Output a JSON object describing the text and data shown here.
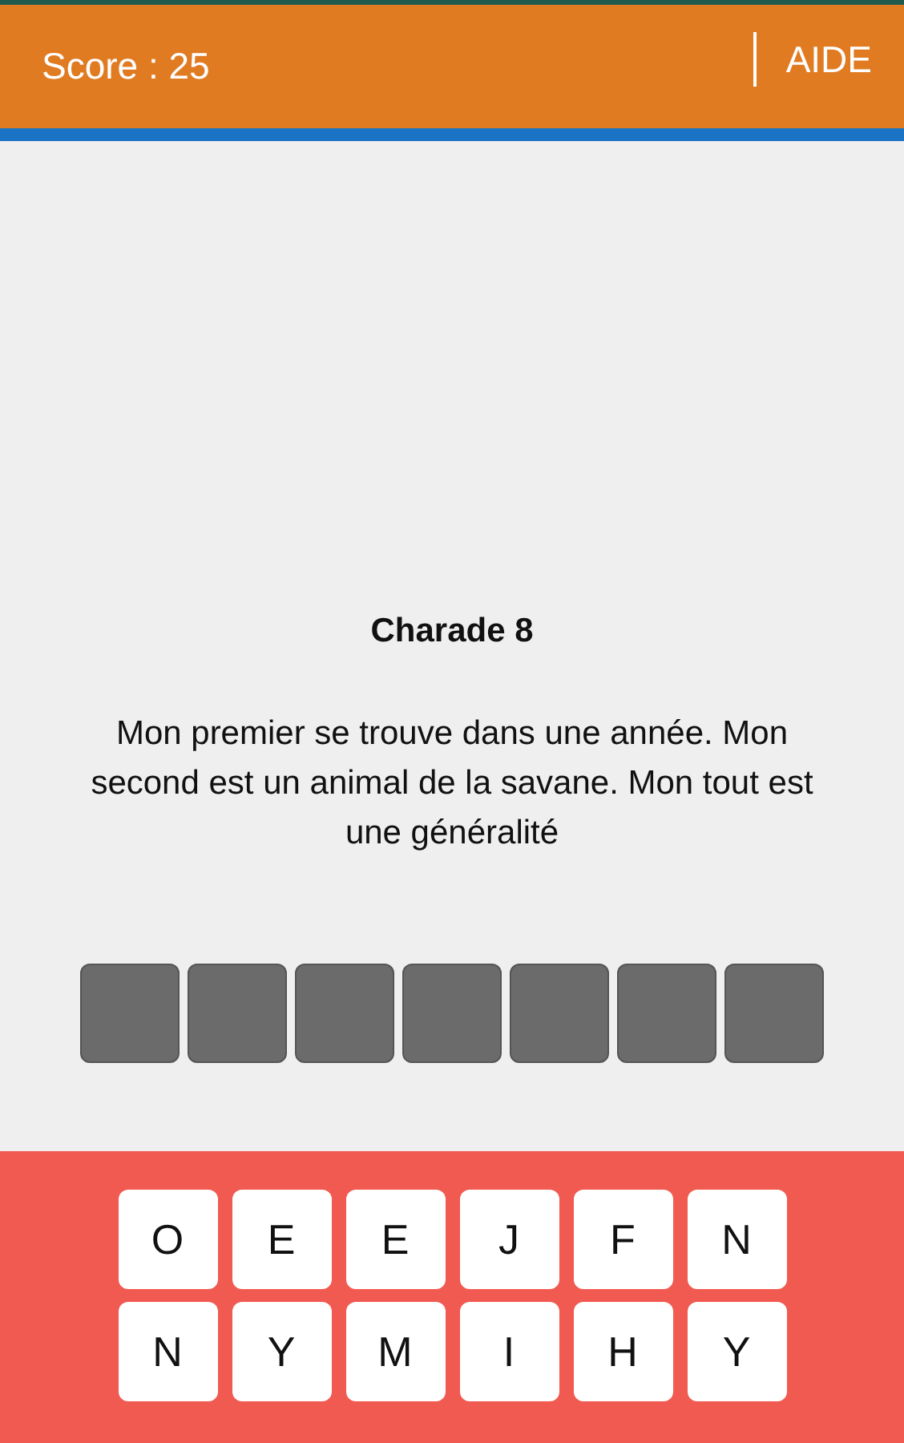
{
  "header": {
    "score": "Score : 25",
    "help_button": "AIDE"
  },
  "puzzle": {
    "title": "Charade 8",
    "text": "Mon premier se trouve dans une année. Mon second est un animal de la savane. Mon tout est une généralité"
  },
  "answer_slots": [
    {
      "filled": false
    },
    {
      "filled": false
    },
    {
      "filled": false
    },
    {
      "filled": false
    },
    {
      "filled": false
    },
    {
      "filled": false
    },
    {
      "filled": false
    }
  ],
  "keyboard": [
    [
      "O",
      "E",
      "E",
      "J",
      "F",
      "N"
    ],
    [
      "N",
      "Y",
      "M",
      "I",
      "H",
      "Y"
    ]
  ]
}
